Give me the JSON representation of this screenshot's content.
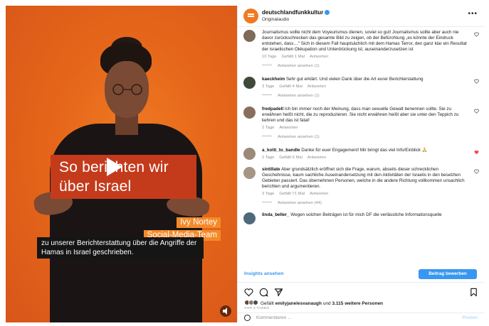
{
  "post": {
    "account": "deutschlandfunkkultur",
    "audio": "Originalaudio"
  },
  "video": {
    "title_line1": "So berichten wir",
    "title_line2": "über Israel",
    "speaker_name": "Ivy Nortey",
    "speaker_role": "Social-Media-Team",
    "subtitle": "zu unserer Berichterstattung über die Angriffe der Hamas in Israel geschrieben."
  },
  "comments": [
    {
      "user": "",
      "text": "Journalismus sollte nicht dem Voyeurismus dienen, soviel so gut! Journalismus sollte aber auch nie davor zurückschrecken das gesamte Bild zu zeigen, ob der Befürchtung „es könnte der Eindruck entstehen, dass…\" Sich in diesem Fall hauptsächlich mit dem Hamas Terror, den ganz klar ein Resultat der israelischen Okkupation und Unterdrückung ist, auseinanderzusetzen ist",
      "meta": [
        "10 Tage",
        "Gefällt 1 Mal",
        "Antworten"
      ],
      "replies": "Antworten ansehen (1)",
      "liked": false
    },
    {
      "user": "kaeckheim",
      "text": "Sehr gut erklärt. Und vielen Dank über die Art eurer Berichterstattung",
      "meta": [
        "3 Tage",
        "Gefällt 4 Mal",
        "Antworten"
      ],
      "replies": "Antworten ansehen (1)",
      "liked": false
    },
    {
      "user": "fredpadell",
      "text": "Ich bin immer noch der Meinung, dass man sexuelle Gewalt benennen sollte. Sie zu erwähnen heißt nicht, die zu reproduzieren. Sie nicht erwähnen heißt aber sie unter den Teppich zu kehren und das ist fatal!",
      "meta": [
        "2 Tage",
        "Antworten"
      ],
      "replies": "Antworten ansehen (1)",
      "liked": false
    },
    {
      "user": "a_kotti_to_bandle",
      "text": "Danke für euer Engagement! Mir bringt das viel Info/Einblick 🙏",
      "meta": [
        "2 Tage",
        "Gefällt 6 Mal",
        "Antworten"
      ],
      "replies": "",
      "liked": true
    },
    {
      "user": "sintillate",
      "text": "Aber grundsätzlich eröffnet sich die Frage, warum, abseits dieser schrecklichen Geschehnisse, kaum sachliche Auseinandersetzung mit den Aktivitäten der Israelis in den besetzten Gebieten passiert. Das übernehmen Personen, welche in die andere Richtung vollkommen unsachlich berichten und argumentieren.",
      "meta": [
        "3 Tage",
        "Gefällt 71 Mal",
        "Antworten"
      ],
      "replies": "Antworten ansehen (44)",
      "liked": false
    },
    {
      "user": "linda_beller_",
      "text": "Wegen solchen Beiträgen ist für mich DF die verlässliche Informationsquelle",
      "meta": [],
      "replies": "",
      "liked": false
    }
  ],
  "insights_label": "Insights ansehen",
  "boost_label": "Beitrag bewerben",
  "likes": {
    "text_prefix": "Gefällt",
    "user": "emilyjanelesvanaugh",
    "text_mid": "und",
    "count": "3.115 weitere Personen",
    "date": "VOR 3 TAGEN"
  },
  "add_comment_placeholder": "Kommentieren ...",
  "post_button": "Posten",
  "icons": {
    "heart": "heart-icon",
    "comment": "comment-icon",
    "share": "share-icon",
    "save": "bookmark-icon",
    "more": "more-icon",
    "verified": "verified-icon",
    "emoji": "emoji-icon",
    "play": "play-icon",
    "sound": "sound-icon"
  },
  "colors": {
    "accent": "#3897f0",
    "brand": "#f07a22",
    "title_box": "#c43b1c",
    "liked_heart": "#ed4956"
  }
}
